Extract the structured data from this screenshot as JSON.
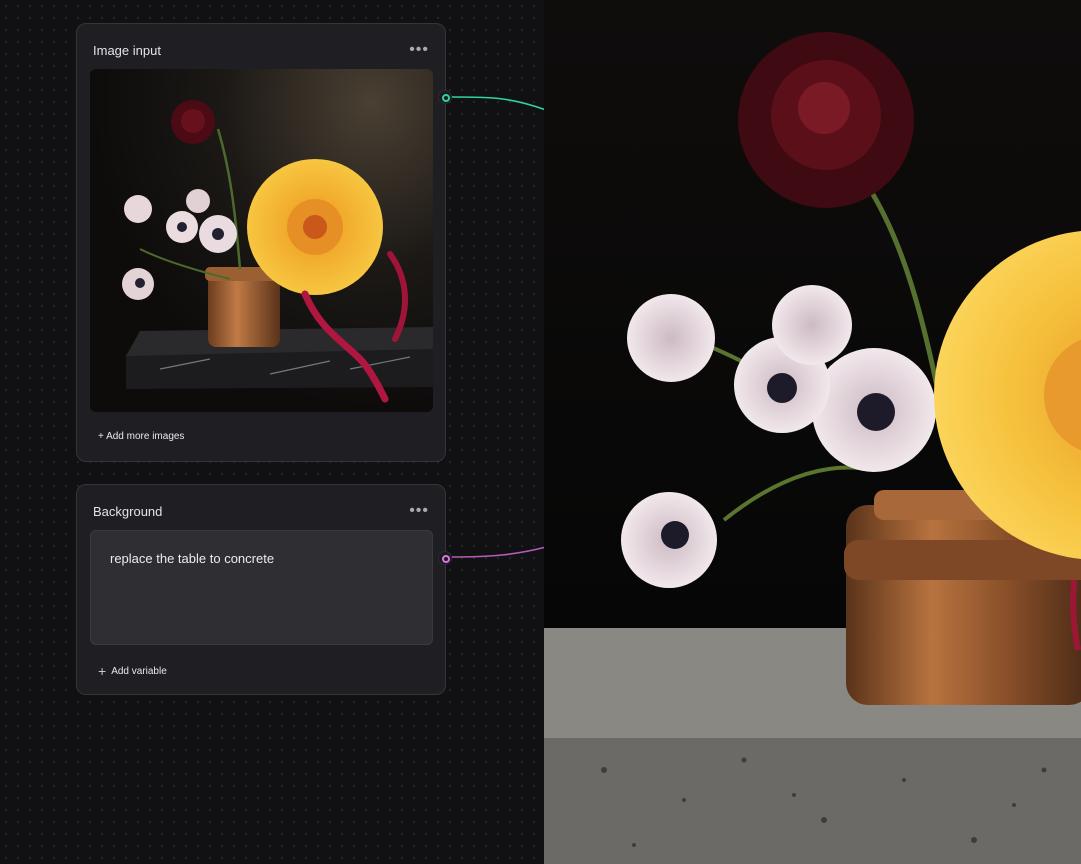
{
  "image_node": {
    "title": "Image input",
    "more_icon": "•••",
    "add_images_label": "+ Add more images",
    "port_color": "#2fd3a0"
  },
  "text_node": {
    "title": "Background",
    "more_icon": "•••",
    "prompt_value": "replace the table to concrete",
    "add_variable_icon": "+",
    "add_variable_label": "Add variable",
    "port_color": "#e072e6"
  },
  "output": {
    "description_icon": "image-output-icon"
  }
}
